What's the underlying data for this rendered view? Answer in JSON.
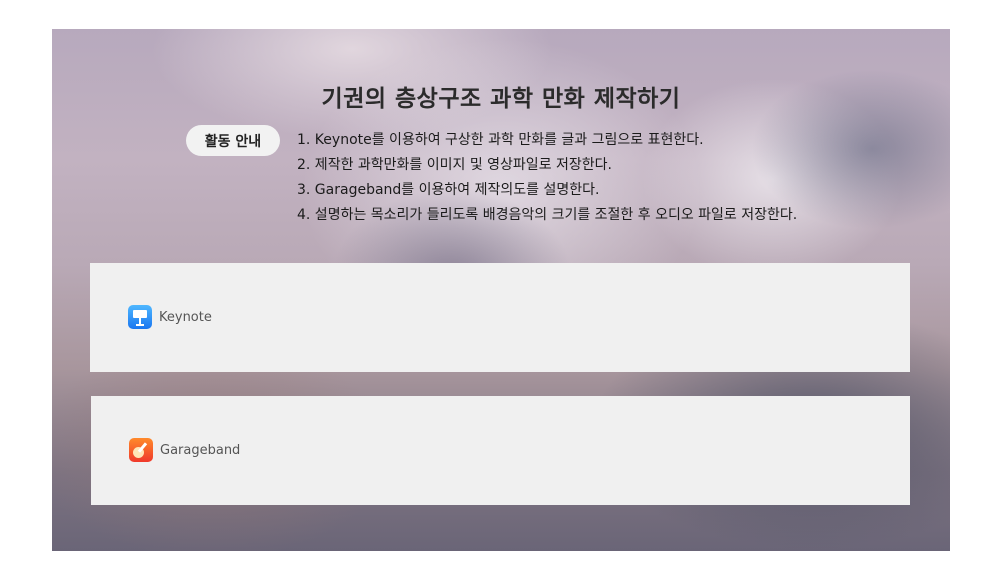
{
  "header": {
    "title": "기권의 층상구조 과학 만화 제작하기"
  },
  "guide": {
    "badge_label": "활동 안내",
    "steps": [
      "1. Keynote를 이용하여 구상한 과학 만화를 글과 그림으로 표현한다.",
      "2. 제작한 과학만화를 이미지 및 영상파일로 저장한다.",
      "3. Garageband를 이용하여 제작의도를 설명한다.",
      "4. 설명하는 목소리가 들리도록 배경음악의 크기를 조절한 후 오디오 파일로 저장한다."
    ]
  },
  "apps": [
    {
      "label": "Keynote",
      "icon": "keynote-icon"
    },
    {
      "label": "Garageband",
      "icon": "garageband-icon"
    }
  ]
}
